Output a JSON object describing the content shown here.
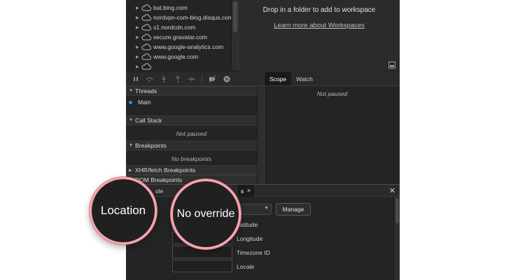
{
  "sources_tree": {
    "items": [
      {
        "label": "bat.bing.com"
      },
      {
        "label": "nordvpn-com-blog.disqus.com"
      },
      {
        "label": "s1.nordcdn.com"
      },
      {
        "label": "secure.gravatar.com"
      },
      {
        "label": "www.google-analytics.com"
      },
      {
        "label": "www.google.com"
      }
    ]
  },
  "workspace": {
    "title": "Drop in a folder to add to workspace",
    "link": "Learn more about Workspaces"
  },
  "debugger_toolbar": {
    "icons": [
      "pause-icon",
      "step-over-icon",
      "step-into-icon",
      "step-out-icon",
      "step-icon",
      "deactivate-breakpoints-icon",
      "pause-on-exceptions-icon"
    ]
  },
  "right_tabs": {
    "scope": "Scope",
    "watch": "Watch",
    "scope_message": "Not paused"
  },
  "sections": {
    "threads": {
      "title": "Threads",
      "main": "Main"
    },
    "call_stack": {
      "title": "Call Stack",
      "message": "Not paused"
    },
    "breakpoints": {
      "title": "Breakpoints",
      "message": "No breakpoints"
    },
    "xhr": {
      "title": "XHR/fetch Breakpoints"
    },
    "dom": {
      "title": "DOM Breakpoints"
    }
  },
  "drawer": {
    "tab_console_partial": "ole",
    "tab_active_suffix": "s",
    "manage_label": "Manage",
    "fields": [
      {
        "label": "Latitude"
      },
      {
        "label": "Longitude"
      },
      {
        "label": "Timezone ID"
      },
      {
        "label": "Locale"
      }
    ]
  },
  "callouts": {
    "location": "Location",
    "override": "No override"
  },
  "colors": {
    "panel_bg": "#242424",
    "accent_ring": "#f4a7b0",
    "thread_dot": "#3d86e0"
  }
}
